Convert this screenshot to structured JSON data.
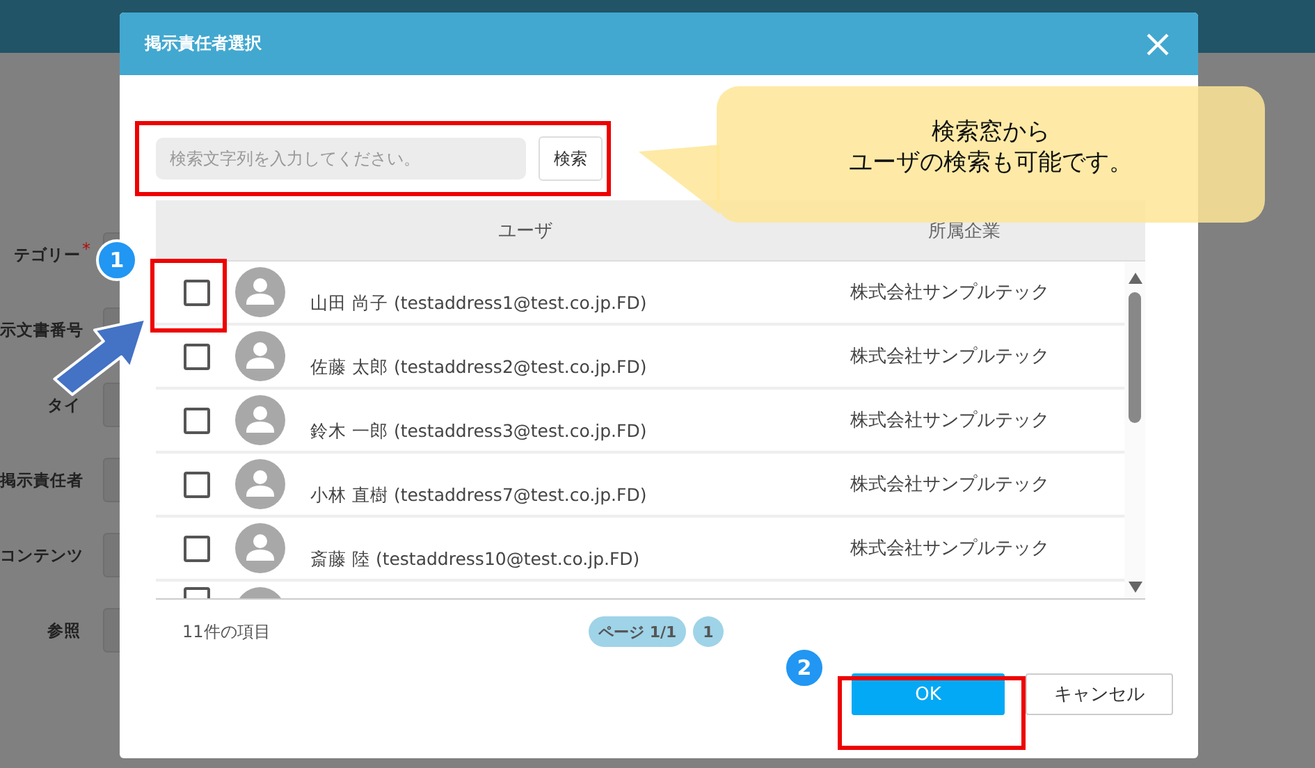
{
  "form_labels": [
    {
      "label": "テゴリー",
      "required": true
    },
    {
      "label": "示文書番号"
    },
    {
      "label": "タイ"
    },
    {
      "label": "掲示責任者"
    },
    {
      "label": "コンテンツ"
    },
    {
      "label": "参照"
    }
  ],
  "required_mark": "*",
  "dialog": {
    "title": "掲示責任者選択",
    "search": {
      "placeholder": "検索文字列を入力してください。",
      "button": "検索"
    },
    "columns": [
      "ユーザ",
      "所属企業"
    ],
    "rows": [
      {
        "kind": "full",
        "checked": false,
        "name": "山田 尚子 (testaddress1@test.co.jp.FD)",
        "company": "株式会社サンプルテック"
      },
      {
        "kind": "full",
        "checked": false,
        "name": "佐藤 太郎 (testaddress2@test.co.jp.FD)",
        "company": "株式会社サンプルテック"
      },
      {
        "kind": "full",
        "checked": false,
        "name": "鈴木 一郎 (testaddress3@test.co.jp.FD)",
        "company": "株式会社サンプルテック"
      },
      {
        "kind": "full",
        "checked": false,
        "name": "小林 直樹 (testaddress7@test.co.jp.FD)",
        "company": "株式会社サンプルテック"
      },
      {
        "kind": "full",
        "checked": false,
        "name": "斎藤 陸 (testaddress10@test.co.jp.FD)",
        "company": "株式会社サンプルテック"
      },
      {
        "kind": "cut",
        "checked": false
      }
    ],
    "count": "11件の項目",
    "pages": [
      {
        "label": "ページ 1/1"
      },
      {
        "label": "1"
      }
    ],
    "buttons": [
      {
        "label": "OK",
        "kind": "primary"
      },
      {
        "label": "キャンセル",
        "kind": "secondary"
      }
    ]
  },
  "callout": {
    "lines": [
      "検索窓から",
      "ユーザの検索も可能です。"
    ]
  },
  "steps": [
    "1",
    "2"
  ]
}
